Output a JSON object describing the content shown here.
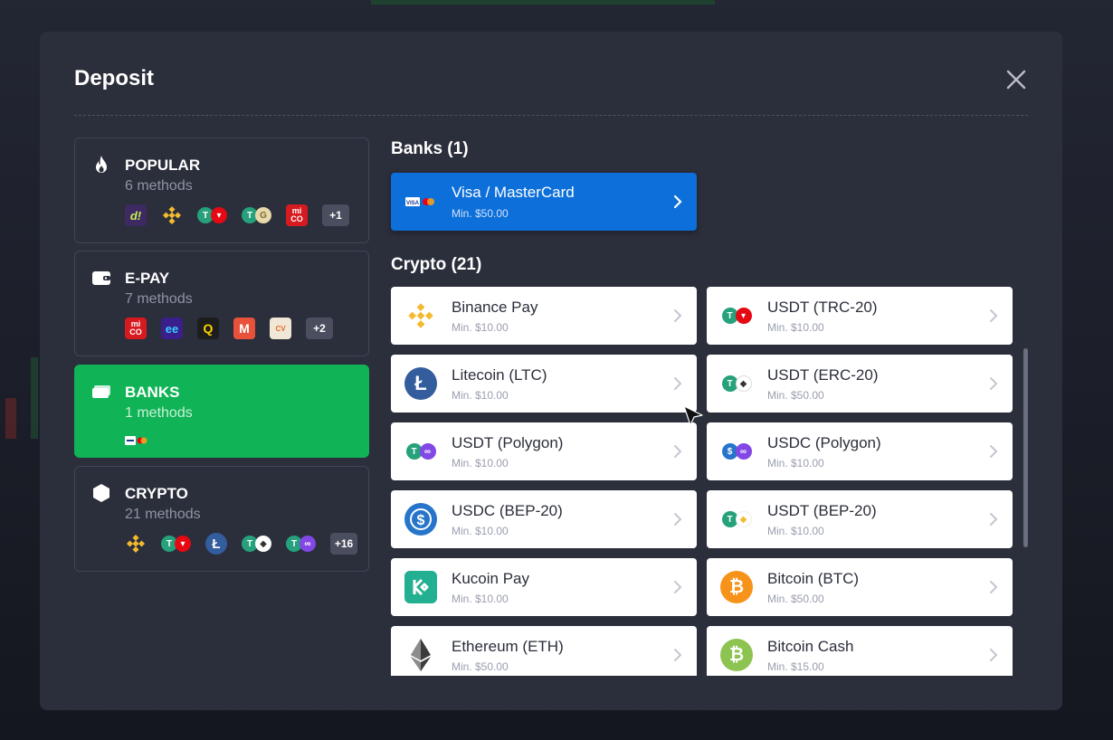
{
  "modal": {
    "title": "Deposit"
  },
  "categories": [
    {
      "name": "POPULAR",
      "count": "6 methods",
      "icon": "fire-icon",
      "more": "+1"
    },
    {
      "name": "E-PAY",
      "count": "7 methods",
      "icon": "wallet-icon",
      "more": "+2"
    },
    {
      "name": "BANKS",
      "count": "1 methods",
      "icon": "card-stack-icon"
    },
    {
      "name": "CRYPTO",
      "count": "21 methods",
      "icon": "hexagon-icon",
      "more": "+16"
    }
  ],
  "banks": {
    "title": "Banks (1)",
    "items": [
      {
        "name": "Visa / MasterCard",
        "min": "Min. $50.00"
      }
    ]
  },
  "crypto": {
    "title": "Crypto (21)",
    "items": [
      {
        "name": "Binance Pay",
        "min": "Min. $10.00"
      },
      {
        "name": "USDT (TRC-20)",
        "min": "Min. $10.00"
      },
      {
        "name": "Litecoin (LTC)",
        "min": "Min. $10.00"
      },
      {
        "name": "USDT (ERC-20)",
        "min": "Min. $50.00"
      },
      {
        "name": "USDT (Polygon)",
        "min": "Min. $10.00"
      },
      {
        "name": "USDC (Polygon)",
        "min": "Min. $10.00"
      },
      {
        "name": "USDC (BEP-20)",
        "min": "Min. $10.00"
      },
      {
        "name": "USDT (BEP-20)",
        "min": "Min. $10.00"
      },
      {
        "name": "Kucoin Pay",
        "min": "Min. $10.00"
      },
      {
        "name": "Bitcoin (BTC)",
        "min": "Min. $50.00"
      },
      {
        "name": "Ethereum (ETH)",
        "min": "Min. $50.00"
      },
      {
        "name": "Bitcoin Cash",
        "min": "Min. $15.00"
      }
    ]
  },
  "colors": {
    "modal_bg": "#2b2e3b",
    "active_category": "#10b355",
    "primary_method": "#0d6fd9",
    "tether": "#26a17b",
    "tron": "#e50914",
    "binance": "#f3ba2f",
    "litecoin": "#345d9d",
    "usdc": "#2775ca",
    "polygon": "#8247e5",
    "kucoin": "#23af91",
    "bitcoin": "#f7931a",
    "bitcoin_cash": "#8dc351"
  }
}
